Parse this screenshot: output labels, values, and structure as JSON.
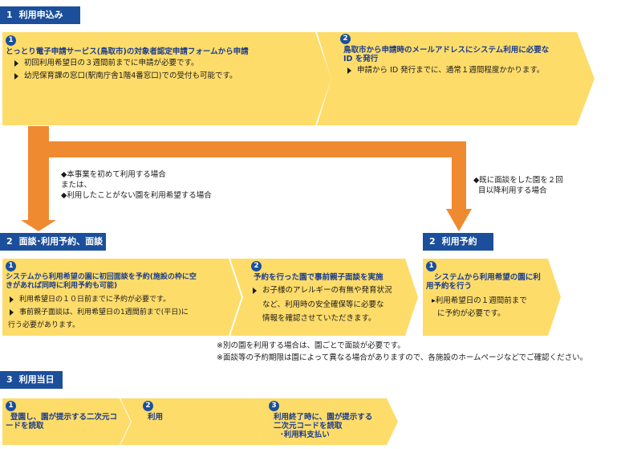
{
  "colors": {
    "header": "#1b4f9c",
    "box": "#fedc6a",
    "arrow": "#f08a30",
    "title": "#1b3c8c"
  },
  "section1": {
    "num": "1",
    "label": "利用申込み",
    "step1": {
      "num": "1",
      "title": "とっとり電子申請サービス(鳥取市)の対象者認定申請フォームから申請",
      "bullets": [
        "初回利用希望日の３週間前までに申請が必要です。",
        "幼児保育課の窓口(駅南庁舎1階4番窓口)での受付も可能です。"
      ]
    },
    "step2": {
      "num": "2",
      "title_line1": "鳥取市から申請時のメールアドレスにシステム利用に必要な",
      "title_line2": "ID を発行",
      "bullets": [
        "申請から ID 発行までに、通常１週間程度かかります。"
      ]
    }
  },
  "branch_left": {
    "line1": "◆本事業を初めて利用する場合",
    "line2": "または、",
    "line3": "◆利用したことがない園を利用希望する場合"
  },
  "branch_right": {
    "line1": "◆既に面談をした園を２回",
    "line2": "目以降利用する場合"
  },
  "section2": {
    "num": "2",
    "label": "面談･利用予約、面談",
    "step1": {
      "num": "1",
      "title_line1": "システムから利用希望の園に初回面談を予約(施設の枠に空",
      "title_line2": "きがあれば同時に利用予約も可能)",
      "bullet1": "利用希望日の１０日前までに予約が必要です。",
      "bullet2_line1": "事前親子面談は、利用希望日の1週間前まで(平日)に",
      "bullet2_line2": "行う必要があります。"
    },
    "step2": {
      "num": "2",
      "title": "予約を行った園で事前親子面談を実施",
      "bullet_line1": "お子様のアレルギーの有無や発育状況",
      "bullet_line2": "など、利用時の安全確保等に必要な",
      "bullet_line3": "情報を確認させていただきます。"
    }
  },
  "section2b": {
    "num": "2",
    "label": "利用予約",
    "step1": {
      "num": "1",
      "title_line1": "システムから利用希望の園に利",
      "title_line2": "用予約を行う",
      "bullet_line1": "▸利用希望日の１週間前まで",
      "bullet_line2": "に予約が必要です。"
    }
  },
  "notes": {
    "line1": "※別の園を利用する場合は、園ごとで面談が必要です。",
    "line2": "※面談等の予約期限は園によって異なる場合がありますので、各施設のホームページなどでご確認ください。"
  },
  "section3": {
    "num": "3",
    "label": "利用当日",
    "step1": {
      "num": "1",
      "title_line1": "登園し、園が提示する二次元コ",
      "title_line2": "ードを読取"
    },
    "step2": {
      "num": "2",
      "title": "利用"
    },
    "step3": {
      "num": "3",
      "title_line1": "利用終了時に、園が提示する",
      "title_line2": "二次元コードを読取",
      "title_line3": "･利用料支払い"
    }
  }
}
